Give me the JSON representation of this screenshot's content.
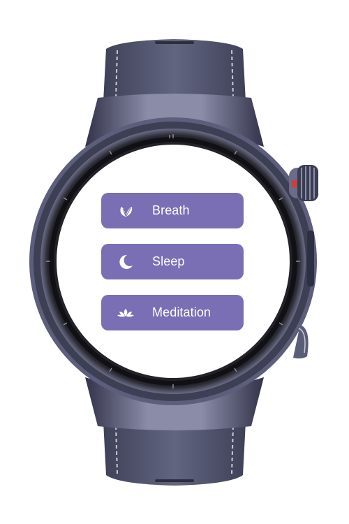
{
  "theme": {
    "accent": "#7a6fb4",
    "strap": "#4e5069",
    "case": "#5a5b78",
    "bezel": "#1c1c22",
    "crown_accent": "#d53b3b"
  },
  "menu": {
    "items": [
      {
        "label": "Breath",
        "icon": "leaf-icon"
      },
      {
        "label": "Sleep",
        "icon": "moon-icon"
      },
      {
        "label": "Meditation",
        "icon": "lotus-icon"
      }
    ]
  }
}
